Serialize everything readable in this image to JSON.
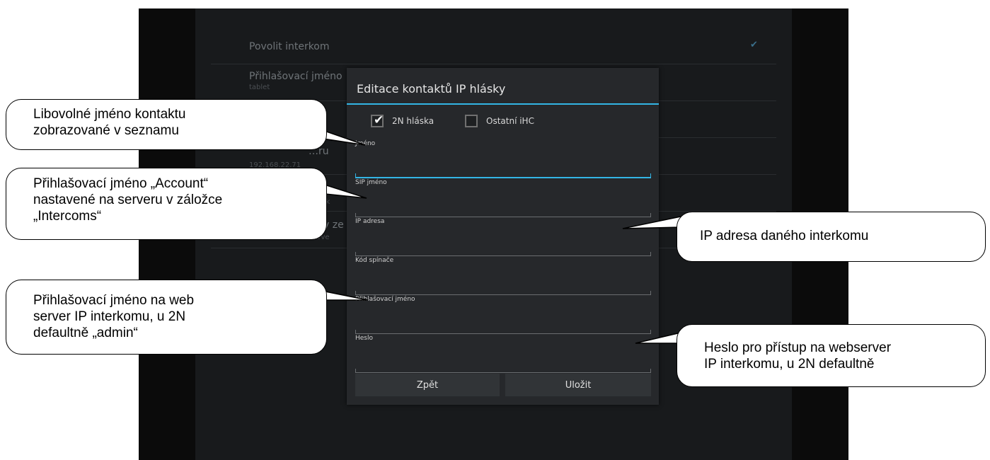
{
  "background_settings": {
    "items": [
      {
        "label": "Povolit interkom",
        "checked": true
      },
      {
        "label": "Přihlašovací jméno",
        "sub": "tablet"
      },
      {
        "label": "",
        "sub": ""
      },
      {
        "label": "…ru",
        "sub": "192.168.22.71"
      },
      {
        "label": "",
        "sub": "hlásk"
      },
      {
        "label": "…y ze",
        "sub": "serve"
      }
    ]
  },
  "dialog": {
    "title": "Editace kontaktů IP hlásky",
    "checkbox_2n": {
      "label": "2N hláska",
      "checked": true
    },
    "checkbox_other": {
      "label": "Ostatní iHC",
      "checked": false
    },
    "fields": {
      "name": {
        "label": "Jméno",
        "value": ""
      },
      "sip": {
        "label": "SIP jméno",
        "value": ""
      },
      "ip": {
        "label": "IP adresa",
        "value": ""
      },
      "switch": {
        "label": "Kód spínače",
        "value": ""
      },
      "login": {
        "label": "Přihlašovací jméno",
        "value": ""
      },
      "password": {
        "label": "Heslo",
        "value": ""
      }
    },
    "back_label": "Zpět",
    "save_label": "Uložit"
  },
  "callouts": {
    "name": [
      "Libovolné jméno kontaktu",
      "zobrazované v seznamu"
    ],
    "account": [
      "Přihlašovací jméno „Account“",
      "nastavené na serveru v záložce",
      "„Intercoms“"
    ],
    "ip": [
      "IP adresa daného interkomu"
    ],
    "web_login": [
      "Přihlašovací jméno na web",
      "server IP interkomu, u 2N",
      "defaultně „admin“"
    ],
    "password": [
      "Heslo pro přístup na webserver",
      "IP interkomu, u 2N defaultně"
    ]
  },
  "colors": {
    "accent": "#33b5e5",
    "dialog_bg": "#26282b",
    "screen_bg": "#181a1c"
  }
}
